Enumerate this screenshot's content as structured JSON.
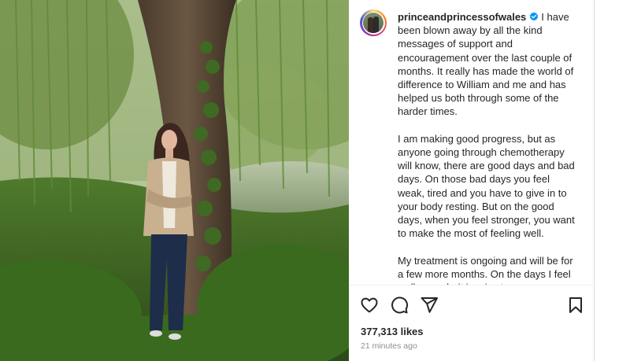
{
  "post": {
    "image_alt": "Photo of a woman leaning against a willow tree",
    "username": "princeandprincessofwales",
    "verified": true,
    "caption": "I have been blown away by all the kind messages of support and encouragement over the last couple of months. It really has made the world of difference to William and me and has helped us both through some of the harder times.\n\nI am making good progress, but as anyone going through chemotherapy will know, there are good days and bad days. On those bad days you feel weak, tired and you have to give in to your body resting. But on the good days, when you feel stronger, you want to make the most of feeling well.\n\nMy treatment is ongoing and will be for a few more months. On the days I feel well enough, it is a joy to engage",
    "likes": "377,313 likes",
    "time_ago": "21 minutes ago"
  },
  "actions": {
    "like_icon": "heart-icon",
    "comment_icon": "comment-icon",
    "share_icon": "share-icon",
    "save_icon": "bookmark-icon"
  },
  "colors": {
    "verified": "#0095f6",
    "text": "#262626",
    "muted": "#8e8e8e"
  }
}
